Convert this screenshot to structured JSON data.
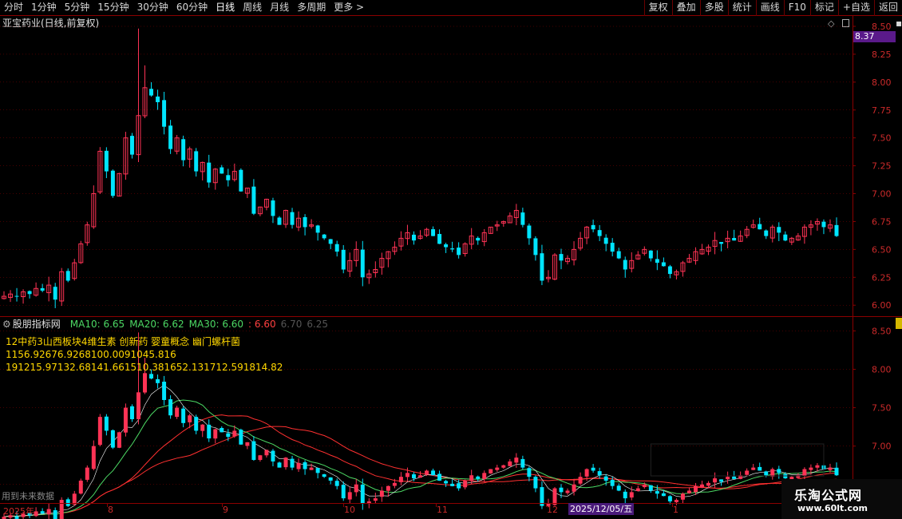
{
  "toolbar": {
    "periods": [
      "分时",
      "1分钟",
      "5分钟",
      "15分钟",
      "30分钟",
      "60分钟",
      "日线",
      "周线",
      "月线",
      "多周期",
      "更多 >"
    ],
    "active_period": "日线",
    "actions": [
      "复权",
      "叠加",
      "多股",
      "统计",
      "画线",
      "F10",
      "标记",
      "+自选",
      "返回"
    ]
  },
  "chart": {
    "title": "亚宝药业(日线,前复权)",
    "current_price_tag": "8.37",
    "price_ticks": [
      "8.50",
      "8.25",
      "8.00",
      "7.75",
      "7.50",
      "7.25",
      "7.00",
      "6.75",
      "6.50",
      "6.25",
      "6.00"
    ]
  },
  "indicator": {
    "name": "股朋指标网",
    "ma10": "MA10: 6.65",
    "ma20": "MA20: 6.62",
    "ma30": "MA30: 6.60",
    "extra": ": 6.60",
    "faded1": "6.70",
    "faded2": "6.25",
    "line1": "12中药3山西板块4维生素 创新药 婴童概念 幽门螺杆菌",
    "line2": "1156.92676.9268100.0091045.816",
    "line3": "191215.97132.68141.661510.381652.131712.591814.82",
    "ticks": [
      "8.50",
      "8.00",
      "7.50",
      "7.00",
      "6.50"
    ]
  },
  "time_axis": {
    "labels": [
      "2025年",
      "8",
      "9",
      "10",
      "11",
      "12",
      "1"
    ],
    "date_marker": "2025/12/05/五",
    "note": "用到未来数据"
  },
  "watermark": {
    "title": "乐淘公式网",
    "url": "www.60lt.com"
  },
  "colors": {
    "up": "#ff3355",
    "down": "#00e5ff",
    "grid": "#8b0000",
    "ma_green": "#4cd964",
    "ma_red": "#ff3030",
    "label_red": "#cc2a2a",
    "accent_purple": "#5a1a8a"
  },
  "chart_data": {
    "type": "candlestick",
    "y_range_main": [
      5.93,
      8.55
    ],
    "y_range_indicator": [
      6.3,
      8.65
    ],
    "closes": [
      6.08,
      6.1,
      6.08,
      6.12,
      6.1,
      6.15,
      6.13,
      6.18,
      6.05,
      6.3,
      6.22,
      6.38,
      6.55,
      6.72,
      7.0,
      7.38,
      7.2,
      6.98,
      7.18,
      7.5,
      7.35,
      7.7,
      7.95,
      7.88,
      7.82,
      7.6,
      7.4,
      7.5,
      7.3,
      7.4,
      7.2,
      7.28,
      7.1,
      7.22,
      7.18,
      7.12,
      7.2,
      7.02,
      7.05,
      6.82,
      6.88,
      6.95,
      6.8,
      6.72,
      6.85,
      6.72,
      6.78,
      6.7,
      6.72,
      6.65,
      6.6,
      6.55,
      6.48,
      6.32,
      6.4,
      6.5,
      6.25,
      6.28,
      6.32,
      6.42,
      6.48,
      6.52,
      6.6,
      6.65,
      6.58,
      6.62,
      6.68,
      6.62,
      6.55,
      6.52,
      6.5,
      6.45,
      6.55,
      6.62,
      6.58,
      6.65,
      6.7,
      6.72,
      6.75,
      6.8,
      6.85,
      6.72,
      6.6,
      6.45,
      6.22,
      6.25,
      6.45,
      6.4,
      6.42,
      6.5,
      6.6,
      6.7,
      6.68,
      6.62,
      6.55,
      6.48,
      6.42,
      6.32,
      6.4,
      6.45,
      6.5,
      6.42,
      6.38,
      6.35,
      6.28,
      6.3,
      6.38,
      6.42,
      6.48,
      6.5,
      6.52,
      6.58,
      6.55,
      6.6,
      6.58,
      6.62,
      6.68,
      6.72,
      6.68,
      6.62,
      6.7,
      6.65,
      6.58,
      6.6,
      6.62,
      6.7,
      6.72,
      6.75,
      6.7,
      6.72,
      6.62
    ]
  }
}
